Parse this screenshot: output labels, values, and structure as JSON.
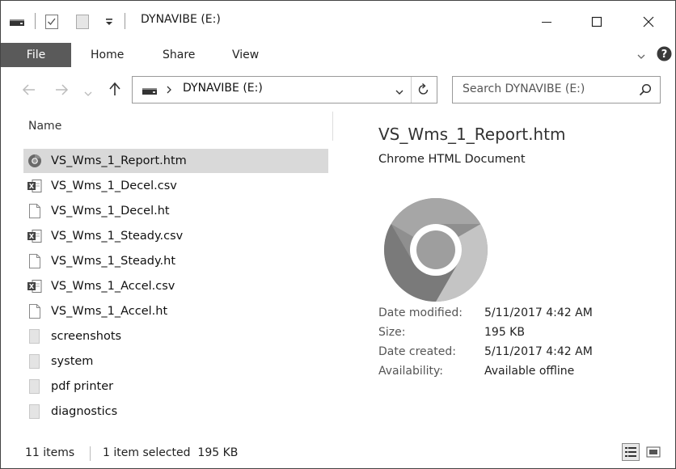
{
  "window": {
    "title": "DYNAVIBE (E:)"
  },
  "ribbon": {
    "tabs": [
      "File",
      "Home",
      "Share",
      "View"
    ]
  },
  "address": {
    "location": "DYNAVIBE (E:)",
    "search_placeholder": "Search DYNAVIBE (E:)"
  },
  "list": {
    "column_header": "Name",
    "items": [
      {
        "name": "VS_Wms_1_Report.htm",
        "icon": "chrome-icon",
        "selected": true
      },
      {
        "name": "VS_Wms_1_Decel.csv",
        "icon": "excel-csv-icon"
      },
      {
        "name": "VS_Wms_1_Decel.ht",
        "icon": "file-icon"
      },
      {
        "name": "VS_Wms_1_Steady.csv",
        "icon": "excel-csv-icon"
      },
      {
        "name": "VS_Wms_1_Steady.ht",
        "icon": "file-icon"
      },
      {
        "name": "VS_Wms_1_Accel.csv",
        "icon": "excel-csv-icon"
      },
      {
        "name": "VS_Wms_1_Accel.ht",
        "icon": "file-icon"
      },
      {
        "name": "screenshots",
        "icon": "file-icon-gray"
      },
      {
        "name": "system",
        "icon": "file-icon-gray"
      },
      {
        "name": "pdf printer",
        "icon": "file-icon-gray"
      },
      {
        "name": "diagnostics",
        "icon": "file-icon-gray"
      }
    ]
  },
  "details": {
    "file_name": "VS_Wms_1_Report.htm",
    "file_type": "Chrome HTML Document",
    "preview_icon": "chrome-logo-icon",
    "properties": [
      {
        "label": "Date modified:",
        "value": "5/11/2017 4:42 AM"
      },
      {
        "label": "Size:",
        "value": "195 KB"
      },
      {
        "label": "Date created:",
        "value": "5/11/2017 4:42 AM"
      },
      {
        "label": "Availability:",
        "value": "Available offline"
      }
    ]
  },
  "status": {
    "item_count": "11 items",
    "selection": "1 item selected  195 KB"
  },
  "colors": {
    "file_tab_bg": "#5a5a5a",
    "selected_row_bg": "#d9d9d9",
    "border": "#9a9a9a"
  }
}
